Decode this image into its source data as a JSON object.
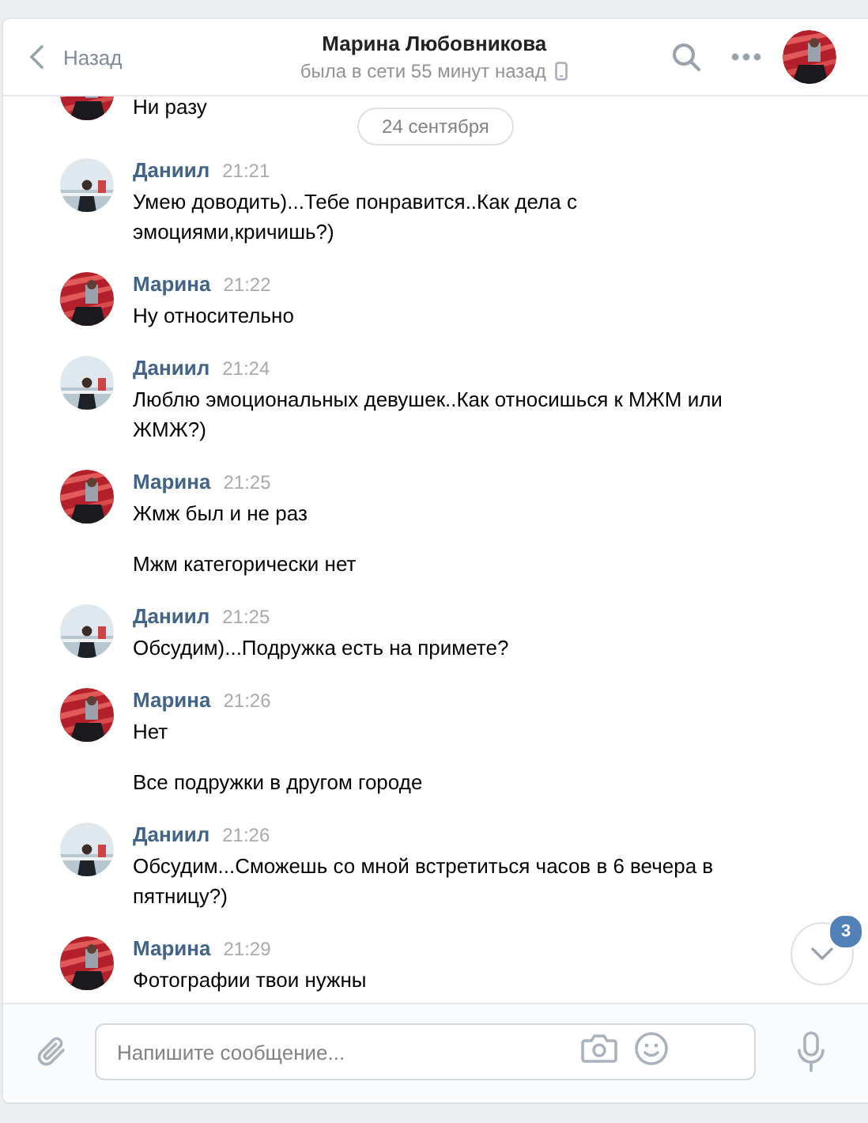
{
  "header": {
    "back_label": "Назад",
    "title": "Марина Любовникова",
    "status": "была в сети 55 минут назад"
  },
  "messages": [
    {
      "kind": "cut_off",
      "texts": [
        "Ни разу"
      ]
    },
    {
      "kind": "date",
      "label": "24 сентября"
    },
    {
      "kind": "group",
      "author": "Даниил",
      "time": "21:21",
      "texts": [
        "Умею доводить)...Тебе понравится..Как дела с эмоциями,кричишь?)"
      ]
    },
    {
      "kind": "group",
      "author": "Марина",
      "time": "21:22",
      "texts": [
        "Ну относительно"
      ]
    },
    {
      "kind": "group",
      "author": "Даниил",
      "time": "21:24",
      "texts": [
        "Люблю эмоциональных девушек..Как относишься к МЖМ или ЖМЖ?)"
      ]
    },
    {
      "kind": "group",
      "author": "Марина",
      "time": "21:25",
      "texts": [
        "Жмж был и не раз",
        "Мжм категорически нет"
      ]
    },
    {
      "kind": "group",
      "author": "Даниил",
      "time": "21:25",
      "texts": [
        "Обсудим)...Подружка есть на примете?"
      ]
    },
    {
      "kind": "group",
      "author": "Марина",
      "time": "21:26",
      "texts": [
        "Нет",
        "Все подружки в другом городе"
      ]
    },
    {
      "kind": "group",
      "author": "Даниил",
      "time": "21:26",
      "texts": [
        "Обсудим...Сможешь со мной встретиться часов в 6 вечера в пятницу?)"
      ]
    },
    {
      "kind": "group",
      "author": "Марина",
      "time": "21:29",
      "texts": [
        "Фотографии твои нужны"
      ]
    }
  ],
  "scroll_down": {
    "badge": "3"
  },
  "composer": {
    "placeholder": "Напишите сообщение..."
  }
}
